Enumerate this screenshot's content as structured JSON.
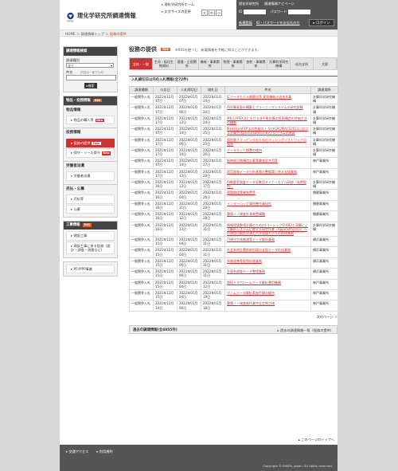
{
  "header": {
    "site_title": "理化学研究所調達情報",
    "logo_text": "RIKEN",
    "top_links": [
      "理化学研究所ホーム",
      "文字サイズの変更"
    ],
    "font_sizes": [
      "大",
      "中",
      "小"
    ]
  },
  "login": {
    "tabs": [
      "理化学研究所",
      "調達情報ナビページ"
    ],
    "id_label": "ID",
    "password_label": "パスワード",
    "links": [
      "新規登録",
      "ID・パスワードをお忘れの方"
    ],
    "login_button": "ログイン"
  },
  "breadcrumb": {
    "home": "HOME",
    "sep": "＞",
    "parent": "調達情報トップ",
    "current": "役務の提供"
  },
  "sidebar": {
    "search_title": "調達情報検索",
    "type_label": "調達種別",
    "type_value": "全て",
    "item_label": "件名",
    "item_hint": "（件名の一部でも可）",
    "search_button": "検索",
    "goods_title": "物品・役務情報",
    "goods_cat": "物品情報",
    "goods_items": [
      {
        "label": "物品の購入等",
        "new": "New"
      }
    ],
    "service_cat": "役務情報",
    "service_items": [
      {
        "label": "役務の提供",
        "new": "New",
        "active": true
      },
      {
        "label": "保守・リース保守",
        "new": "New",
        "active": false
      }
    ],
    "labor_cat": "労働者派遣",
    "labor_items": [
      {
        "label": "労働者派遣"
      }
    ],
    "sale_cat": "売払・公募",
    "sale_items": [
      {
        "label": "売払等"
      },
      {
        "label": "公募"
      }
    ],
    "construction_title": "工事情報",
    "construction_items": [
      {
        "label": "建設工事"
      },
      {
        "label": "建設工事に係る役務（設計・調査・測量など）"
      }
    ],
    "pdf_label": "PFI/PPP事業"
  },
  "rss_label": "RSS",
  "new_label": "New",
  "main": {
    "title": "役務の提供",
    "desc": "※RSSを使うと、新着情報を手軽に知ることができます。",
    "tabs": [
      "全体・一般",
      "生命・転化生物資料",
      "基盤・企画関係",
      "機械・事業関係",
      "物理・事業関係",
      "放射・事業関係",
      "計算科学研究機構",
      "仙台支所",
      "大阪"
    ],
    "section_title": "入札締切日以内の入札情報(全72件)",
    "columns": [
      "調達種類",
      "公告日",
      "入札締切日",
      "開札日",
      "件名",
      "調達場所"
    ],
    "rows": [
      [
        "一般競争入札",
        "2021年12月17日",
        "2022年01月07日",
        "2022年01月24日",
        "ICデータモデル階層化等 意見機能の追加作業",
        "計算科学研究機構"
      ],
      [
        "一般競争入札",
        "2021年12月17日",
        "2022年01月06日",
        "2022年01月24日",
        "AI計算資源の構築とプランニングシステムの研究試験",
        "計算科学研究機構"
      ],
      [
        "一般競争入札",
        "2021年12月17日",
        "2022年01月13日",
        "2022年01月24日",
        "MR-CAPEX法における非平衡計算の役割構造の評価方法の構築",
        "計算科学研究機構"
      ],
      [
        "一般競争入札",
        "2021年12月17日",
        "2022年01月14日",
        "2022年01月25日",
        "ModelsimFEP法の性能向上 及びGROMACS2021における計算方法perturbation/FEPプログラムの開発",
        "計算科学研究機構"
      ],
      [
        "一般競争入札",
        "2021年12月17日",
        "2022年01月06日",
        "2022年01月25日",
        "個別量子マッピングのためのマッシングソフトウェアの開発",
        "計算科学研究機構"
      ],
      [
        "一般競争入札",
        "2021年12月17日",
        "2022年01月14日",
        "2022年01月26日",
        "データセット調整の維持",
        "計算科学研究機構"
      ],
      [
        "一般競争入札",
        "2021年12月17日",
        "2022年01月14日",
        "2022年01月27日",
        "脳神経回路構造計算実験施設共用等",
        "神戸事業所"
      ],
      [
        "一般競争入札",
        "2021年12月17日",
        "2022年01月13日",
        "2022年01月28日",
        "医用画像データ分析基盤の整備実に係る支援業務",
        "神戸事業所"
      ],
      [
        "一般競争入札",
        "2021年12月16日",
        "2022年01月13日",
        "2022年01月17日",
        "AI概要室調査データ収集用タイナーモデル研修（長期契約）",
        "計算科学研究機構"
      ],
      [
        "一般競争入札",
        "2021年12月16日",
        "2022年01月04日",
        "2022年01月26日",
        "理論物理実験装置等",
        "播磨事業所"
      ],
      [
        "一般競争入札",
        "2021年12月16日",
        "2022年01月11日",
        "2022年01月28日",
        "インターロック事所整作業研究",
        "播磨事業所"
      ],
      [
        "一般競争入札",
        "2021年12月16日",
        "2022年01月12日",
        "2022年01月28日",
        "重陽ミノ検査計測装置構築",
        "播磨事業所"
      ],
      [
        "一般競争入札",
        "2021年12月16日",
        "2022年01月13日",
        "2022年01月31日",
        "情報理論数値計算のための(ベーシックCUBE)と演算による解析システムに関する研究作業（ApproxPhysics）への適用可能性評価と大学理論モデルの作成業務",
        "計算科学研究機構"
      ],
      [
        "一般競争入札",
        "2021年12月15日",
        "2022年01月04日",
        "2022年01月31日",
        "可視光生体観測等データ解析業務",
        "横浜事業所"
      ],
      [
        "一般競争入札",
        "2021年12月15日",
        "2022年01月04日",
        "2022年01月31日",
        "社会系統計関係前処理の支援データ作成業務",
        "横浜事業所"
      ],
      [
        "一般競争入札",
        "2021年12月15日",
        "2022年01月06日",
        "2022年01月31日",
        "体質改善等取得処理業務",
        "横浜事業所"
      ],
      [
        "一般競争入札",
        "2021年12月15日",
        "2022年01月06日",
        "2022年01月31日",
        "計量系調査データ整理業務",
        "横浜事業所"
      ],
      [
        "一般競争入札",
        "2021年12月15日",
        "2022年01月04日",
        "2022年01月12日",
        "理研メタボロームデータ解析運用機構",
        "神戸事業所"
      ],
      [
        "一般競争入札",
        "2021年12月15日",
        "2022年01月04日",
        "2022年01月19日",
        "ゲノムデータ解析実施手順の維持",
        "神戸事業所"
      ],
      [
        "一般競争入札",
        "2021年12月14日",
        "2022年01月06日",
        "2022年01月18日",
        "重陽ノー検査器作業完全定期点検",
        "神戸事業所"
      ]
    ],
    "next_link": "次のページ ＞",
    "past_title": "過去の調達情報(全4855件)",
    "past_link": "過去の調達情報一覧（役務の提供）",
    "page_top": "このページのトップへ"
  },
  "footer": {
    "links": [
      "交通アクセス",
      "利用規約"
    ],
    "copyright": "Copyright © RIKEN, Japan. All rights reserved."
  },
  "colors": {
    "accent": "#cc3333",
    "rss": "#e8632b",
    "dark": "#444444"
  }
}
